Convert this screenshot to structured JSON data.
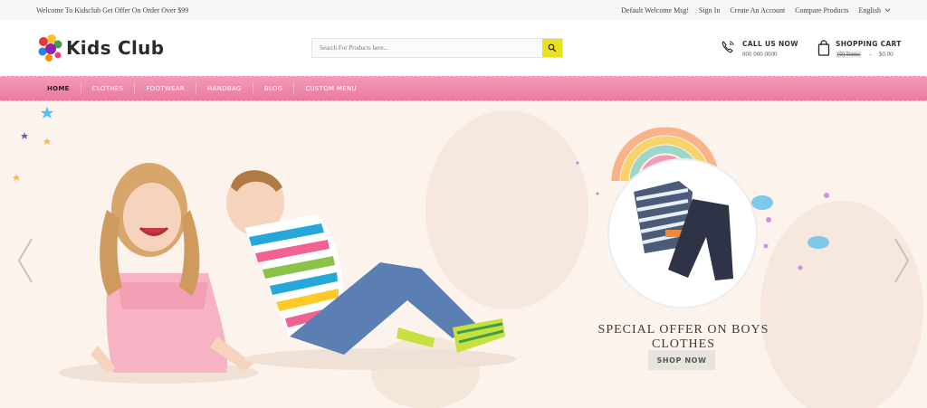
{
  "topbar": {
    "welcome": "Welcome To Kidsclub Get Offer On Order Over $99",
    "links": [
      "Default Welcome Msg!",
      "Sign In",
      "Create An Account",
      "Compare Products"
    ],
    "language": "English"
  },
  "header": {
    "logo_text": "Kids Club",
    "search_placeholder": "Search For Products here...",
    "call_label": "CALL US NOW",
    "call_number": "800 000 0000",
    "cart_label": "SHOPPING CART",
    "cart_items": "(0) Items",
    "cart_sep": "-",
    "cart_total": "$0.00"
  },
  "nav": {
    "items": [
      "HOME",
      "CLOTHES",
      "FOOTWEAR",
      "HANDBAG",
      "BLOG",
      "CUSTOM MENU"
    ],
    "active": "HOME"
  },
  "hero": {
    "title": "SPECIAL OFFER ON BOYS CLOTHES",
    "button": "SHOP NOW"
  },
  "colors": {
    "accent_pink": "#ec82a7",
    "search_yellow": "#e8e21e",
    "hero_bg": "#fbf3ec"
  }
}
